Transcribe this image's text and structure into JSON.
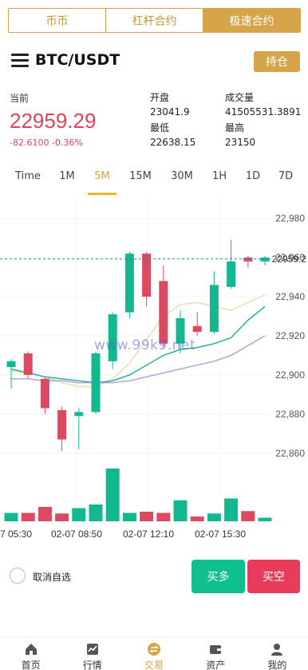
{
  "top_tabs": [
    {
      "label": "币币",
      "active": false
    },
    {
      "label": "杠杆合约",
      "active": false
    },
    {
      "label": "极速合约",
      "active": true
    }
  ],
  "header": {
    "pair": "BTC/USDT",
    "hold_label": "持仓"
  },
  "stats": {
    "now_label": "当前",
    "price": "22959.29",
    "change": "-82.6100 -0.36%",
    "open_label": "开盘",
    "open": "23041.9",
    "volume_label": "成交量",
    "volume": "41505531.3891",
    "low_label": "最低",
    "low": "22638.15",
    "high_label": "最高",
    "high": "23150"
  },
  "periods": [
    {
      "label": "Time",
      "active": false
    },
    {
      "label": "1M",
      "active": false
    },
    {
      "label": "5M",
      "active": true
    },
    {
      "label": "15M",
      "active": false
    },
    {
      "label": "30M",
      "active": false
    },
    {
      "label": "1H",
      "active": false
    },
    {
      "label": "1D",
      "active": false
    },
    {
      "label": "7D",
      "active": false
    }
  ],
  "chart_data": {
    "type": "candlestick",
    "y_ticks": [
      "22,980",
      "22,960",
      "22,940",
      "22,920",
      "22,900",
      "22,880",
      "22,860"
    ],
    "ylim": [
      22855,
      22985
    ],
    "current_price_label": "22959.2",
    "current_price": 22959.29,
    "x_ticks": [
      "7 05:30",
      "02-07 08:50",
      "02-07 12:10",
      "02-07 15:30"
    ],
    "candles": [
      {
        "o": 22904,
        "c": 22907,
        "h": 22908,
        "l": 22893,
        "v": 0.14
      },
      {
        "o": 22911,
        "c": 22900,
        "h": 22912,
        "l": 22898,
        "v": 0.14
      },
      {
        "o": 22898,
        "c": 22883,
        "h": 22899,
        "l": 22880,
        "v": 0.24
      },
      {
        "o": 22882,
        "c": 22867,
        "h": 22884,
        "l": 22861,
        "v": 0.13
      },
      {
        "o": 22879,
        "c": 22881,
        "h": 22883,
        "l": 22862,
        "v": 0.22
      },
      {
        "o": 22881,
        "c": 22911,
        "h": 22912,
        "l": 22880,
        "v": 0.28
      },
      {
        "o": 22907,
        "c": 22931,
        "h": 22932,
        "l": 22903,
        "v": 0.88
      },
      {
        "o": 22932,
        "c": 22962,
        "h": 22963,
        "l": 22929,
        "v": 0.14
      },
      {
        "o": 22962,
        "c": 22940,
        "h": 22963,
        "l": 22935,
        "v": 0.16
      },
      {
        "o": 22948,
        "c": 22916,
        "h": 22956,
        "l": 22914,
        "v": 0.14
      },
      {
        "o": 22916,
        "c": 22929,
        "h": 22933,
        "l": 22911,
        "v": 0.35
      },
      {
        "o": 22925,
        "c": 22922,
        "h": 22932,
        "l": 22920,
        "v": 0.08
      },
      {
        "o": 22922,
        "c": 22946,
        "h": 22953,
        "l": 22921,
        "v": 0.13
      },
      {
        "o": 22945,
        "c": 22958,
        "h": 22969,
        "l": 22944,
        "v": 0.38
      },
      {
        "o": 22960,
        "c": 22958,
        "h": 22961,
        "l": 22955,
        "v": 0.17
      },
      {
        "o": 22958,
        "c": 22960,
        "h": 22961,
        "l": 22956,
        "v": 0.06
      }
    ],
    "ma_lines": [
      {
        "color": "#e8d9b0",
        "values": [
          22902,
          22901,
          22899,
          22896,
          22894,
          22894,
          22898,
          22906,
          22918,
          22930,
          22936,
          22937,
          22935,
          22933,
          22937,
          22941
        ]
      },
      {
        "color": "#17b08a",
        "values": [
          22903,
          22901,
          22899,
          22898,
          22897,
          22896,
          22897,
          22900,
          22905,
          22910,
          22913,
          22914,
          22916,
          22919,
          22928,
          22935
        ]
      },
      {
        "color": "#b79ad8",
        "values": [
          22898,
          22898,
          22897,
          22897,
          22896,
          22896,
          22896,
          22897,
          22899,
          22901,
          22903,
          22905,
          22907,
          22910,
          22915,
          22920
        ]
      }
    ],
    "watermark": "www.99k9.net",
    "up_color": "#11b890",
    "down_color": "#db4a5e"
  },
  "favorite": {
    "label": "取消自选"
  },
  "buttons": {
    "buy": "买多",
    "sell": "买空"
  },
  "nav": [
    {
      "label": "首页",
      "icon": "home-icon",
      "active": false
    },
    {
      "label": "行情",
      "icon": "chart-icon",
      "active": false
    },
    {
      "label": "交易",
      "icon": "exchange-icon",
      "active": true
    },
    {
      "label": "资产",
      "icon": "wallet-icon",
      "active": false
    },
    {
      "label": "我的",
      "icon": "user-icon",
      "active": false
    }
  ]
}
